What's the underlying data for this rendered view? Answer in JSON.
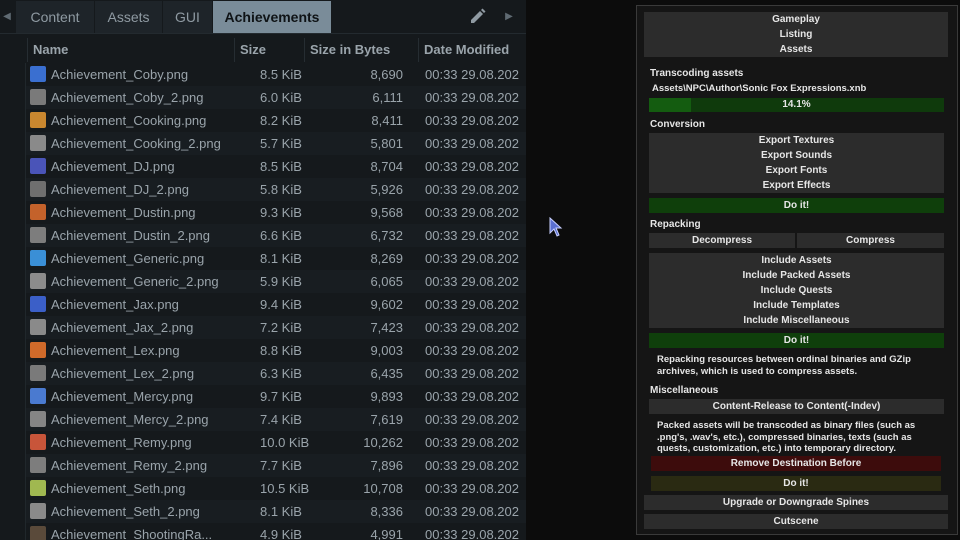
{
  "tabs": [
    "Content",
    "Assets",
    "GUI",
    "Achievements"
  ],
  "active_tab": "Achievements",
  "columns": {
    "name": "Name",
    "size": "Size",
    "bytes": "Size in Bytes",
    "date": "Date Modified"
  },
  "files": [
    {
      "name": "Achievement_Coby.png",
      "size": "8.5 KiB",
      "bytes": "8,690",
      "date": "00:33 29.08.202",
      "color": "#3a6fd0"
    },
    {
      "name": "Achievement_Coby_2.png",
      "size": "6.0 KiB",
      "bytes": "6,111",
      "date": "00:33 29.08.202",
      "color": "#7a7a7a"
    },
    {
      "name": "Achievement_Cooking.png",
      "size": "8.2 KiB",
      "bytes": "8,411",
      "date": "00:33 29.08.202",
      "color": "#c9872f"
    },
    {
      "name": "Achievement_Cooking_2.png",
      "size": "5.7 KiB",
      "bytes": "5,801",
      "date": "00:33 29.08.202",
      "color": "#8a8a8a"
    },
    {
      "name": "Achievement_DJ.png",
      "size": "8.5 KiB",
      "bytes": "8,704",
      "date": "00:33 29.08.202",
      "color": "#4a54b8"
    },
    {
      "name": "Achievement_DJ_2.png",
      "size": "5.8 KiB",
      "bytes": "5,926",
      "date": "00:33 29.08.202",
      "color": "#6f6f6f"
    },
    {
      "name": "Achievement_Dustin.png",
      "size": "9.3 KiB",
      "bytes": "9,568",
      "date": "00:33 29.08.202",
      "color": "#c4622b"
    },
    {
      "name": "Achievement_Dustin_2.png",
      "size": "6.6 KiB",
      "bytes": "6,732",
      "date": "00:33 29.08.202",
      "color": "#7d7d7d"
    },
    {
      "name": "Achievement_Generic.png",
      "size": "8.1 KiB",
      "bytes": "8,269",
      "date": "00:33 29.08.202",
      "color": "#3a8fd6"
    },
    {
      "name": "Achievement_Generic_2.png",
      "size": "5.9 KiB",
      "bytes": "6,065",
      "date": "00:33 29.08.202",
      "color": "#8c8c8c"
    },
    {
      "name": "Achievement_Jax.png",
      "size": "9.4 KiB",
      "bytes": "9,602",
      "date": "00:33 29.08.202",
      "color": "#3b5fc8"
    },
    {
      "name": "Achievement_Jax_2.png",
      "size": "7.2 KiB",
      "bytes": "7,423",
      "date": "00:33 29.08.202",
      "color": "#8a8a8a"
    },
    {
      "name": "Achievement_Lex.png",
      "size": "8.8 KiB",
      "bytes": "9,003",
      "date": "00:33 29.08.202",
      "color": "#d06a2a"
    },
    {
      "name": "Achievement_Lex_2.png",
      "size": "6.3 KiB",
      "bytes": "6,435",
      "date": "00:33 29.08.202",
      "color": "#7a7a7a"
    },
    {
      "name": "Achievement_Mercy.png",
      "size": "9.7 KiB",
      "bytes": "9,893",
      "date": "00:33 29.08.202",
      "color": "#4a7ad0"
    },
    {
      "name": "Achievement_Mercy_2.png",
      "size": "7.4 KiB",
      "bytes": "7,619",
      "date": "00:33 29.08.202",
      "color": "#858585"
    },
    {
      "name": "Achievement_Remy.png",
      "size": "10.0 KiB",
      "bytes": "10,262",
      "date": "00:33 29.08.202",
      "color": "#c8553a"
    },
    {
      "name": "Achievement_Remy_2.png",
      "size": "7.7 KiB",
      "bytes": "7,896",
      "date": "00:33 29.08.202",
      "color": "#7d7d7d"
    },
    {
      "name": "Achievement_Seth.png",
      "size": "10.5 KiB",
      "bytes": "10,708",
      "date": "00:33 29.08.202",
      "color": "#a0b850"
    },
    {
      "name": "Achievement_Seth_2.png",
      "size": "8.1 KiB",
      "bytes": "8,336",
      "date": "00:33 29.08.202",
      "color": "#8a8a8a"
    },
    {
      "name": "Achievement_ShootingRa...",
      "size": "4.9 KiB",
      "bytes": "4,991",
      "date": "00:33 29.08.202",
      "color": "#5a4a3a"
    }
  ],
  "panel": {
    "nav": [
      "Gameplay",
      "Listing",
      "Assets"
    ],
    "transcoding_title": "Transcoding assets",
    "transcoding_path": "Assets\\NPC\\Author\\Sonic Fox Expressions.xnb",
    "progress_text": "14.1%",
    "progress_value": 0.141,
    "conversion_title": "Conversion",
    "conversion_buttons": [
      "Export Textures",
      "Export Sounds",
      "Export Fonts",
      "Export Effects"
    ],
    "do_it": "Do it!",
    "repacking_title": "Repacking",
    "decompress": "Decompress",
    "compress": "Compress",
    "include_buttons": [
      "Include Assets",
      "Include Packed Assets",
      "Include Quests",
      "Include Templates",
      "Include Miscellaneous"
    ],
    "repacking_note": "Repacking resources between ordinal binaries and GZip archives, which is used to compress assets.",
    "misc_title": "Miscellaneous",
    "content_release": "Content-Release to Content(-Indev)",
    "misc_note": "Packed assets will be transcoded as binary files (such as .png's, .wav's, etc.), compressed binaries, texts (such as quests, customization, etc.) into temporary directory.",
    "remove_destination": "Remove Destination Before",
    "upgrade_spines": "Upgrade or Downgrade Spines",
    "cutscene": "Cutscene"
  },
  "colors": {
    "accent_tab": "#7a8c99",
    "do_it_green": "#0f3f0b",
    "remove_red": "#3d0c0c"
  },
  "icons": [
    "chevron-left-icon",
    "chevron-right-icon",
    "pencil-icon",
    "mouse-cursor-icon"
  ]
}
